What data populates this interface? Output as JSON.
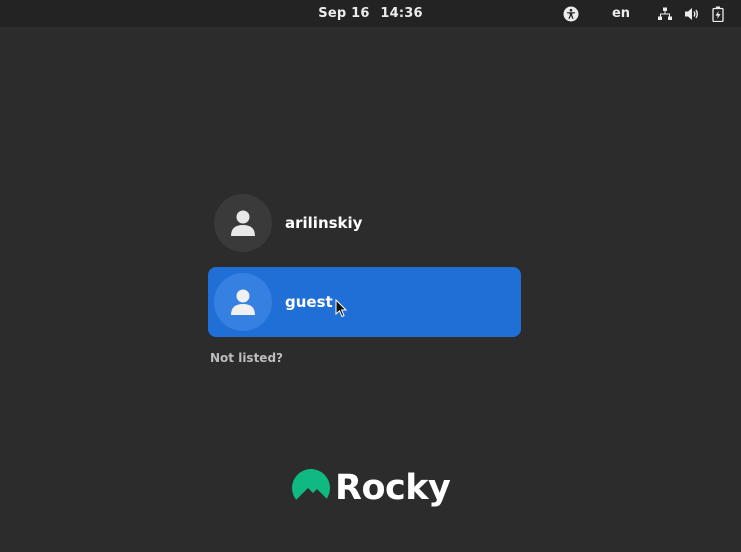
{
  "topbar": {
    "date": "Sep 16",
    "time": "14:36",
    "language": "en",
    "icons": [
      "accessibility-icon",
      "network-icon",
      "volume-icon",
      "battery-icon"
    ]
  },
  "users": [
    {
      "name": "arilinskiy",
      "selected": false
    },
    {
      "name": "guest",
      "selected": true
    }
  ],
  "not_listed_label": "Not listed?",
  "logo": {
    "text": "Rocky",
    "brand_color": "#10b981"
  },
  "colors": {
    "background": "#2c2c2c",
    "topbar": "#232323",
    "selection": "#1f6fd6"
  }
}
